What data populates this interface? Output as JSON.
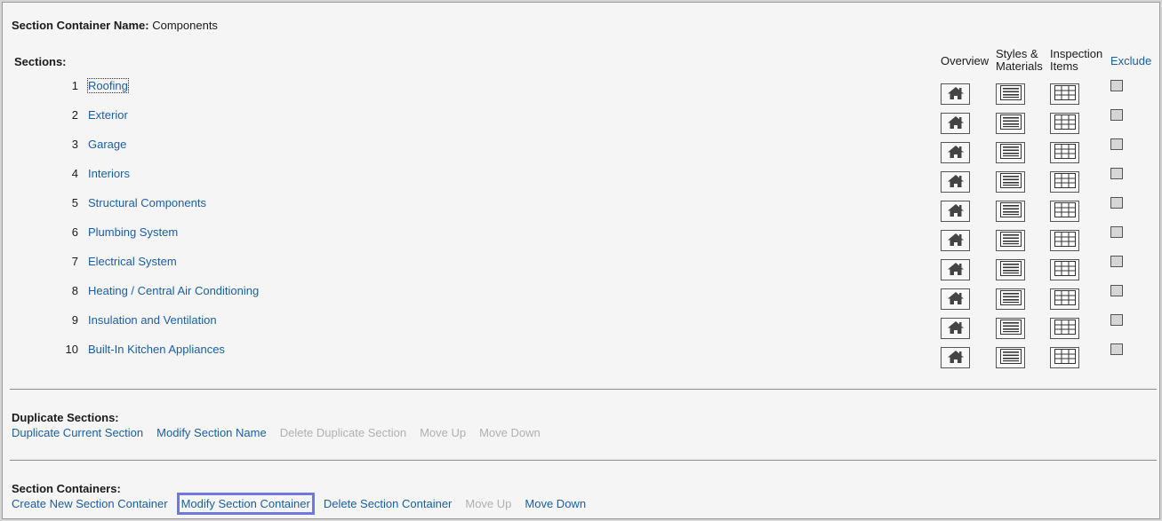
{
  "header": {
    "container_name_label": "Section Container Name:",
    "container_name_value": "Components"
  },
  "sections_label": "Sections:",
  "columns": {
    "overview": "Overview",
    "styles_line1": "Styles &",
    "styles_line2": "Materials",
    "inspection_line1": "Inspection",
    "inspection_line2": "Items",
    "exclude": "Exclude"
  },
  "icons": {
    "overview": "house-icon",
    "styles": "list-icon",
    "inspection": "grid-icon"
  },
  "sections": [
    {
      "num": "1",
      "label": "Roofing"
    },
    {
      "num": "2",
      "label": "Exterior"
    },
    {
      "num": "3",
      "label": "Garage"
    },
    {
      "num": "4",
      "label": "Interiors"
    },
    {
      "num": "5",
      "label": "Structural Components"
    },
    {
      "num": "6",
      "label": "Plumbing System"
    },
    {
      "num": "7",
      "label": "Electrical System"
    },
    {
      "num": "8",
      "label": "Heating / Central Air Conditioning"
    },
    {
      "num": "9",
      "label": "Insulation and Ventilation"
    },
    {
      "num": "10",
      "label": "Built-In Kitchen Appliances"
    }
  ],
  "duplicate_sections": {
    "title": "Duplicate Sections:",
    "actions": [
      {
        "label": "Duplicate Current Section",
        "enabled": true
      },
      {
        "label": "Modify Section Name",
        "enabled": true
      },
      {
        "label": "Delete Duplicate Section",
        "enabled": false
      },
      {
        "label": "Move Up",
        "enabled": false
      },
      {
        "label": "Move Down",
        "enabled": false
      }
    ]
  },
  "section_containers": {
    "title": "Section Containers:",
    "actions": [
      {
        "label": "Create New Section Container",
        "enabled": true
      },
      {
        "label": "Modify Section Container",
        "enabled": true,
        "highlighted": true
      },
      {
        "label": "Delete Section Container",
        "enabled": true
      },
      {
        "label": "Move Up",
        "enabled": false
      },
      {
        "label": "Move Down",
        "enabled": true
      }
    ]
  },
  "colors": {
    "link": "#1a5fa5",
    "disabled": "#b0b0b0",
    "highlight": "#6f78e0"
  }
}
